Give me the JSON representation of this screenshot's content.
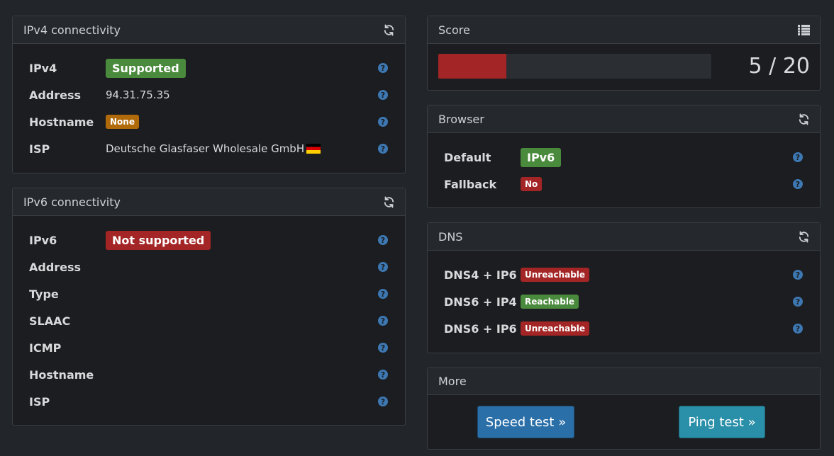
{
  "ipv4": {
    "title": "IPv4 connectivity",
    "rows": [
      {
        "label": "IPv4",
        "value": "Supported"
      },
      {
        "label": "Address",
        "value": "94.31.75.35"
      },
      {
        "label": "Hostname",
        "value": "None"
      },
      {
        "label": "ISP",
        "value": "Deutsche Glasfaser Wholesale GmbH"
      }
    ]
  },
  "ipv6": {
    "title": "IPv6 connectivity",
    "rows": [
      {
        "label": "IPv6",
        "value": "Not supported"
      },
      {
        "label": "Address"
      },
      {
        "label": "Type"
      },
      {
        "label": "SLAAC"
      },
      {
        "label": "ICMP"
      },
      {
        "label": "Hostname"
      },
      {
        "label": "ISP"
      }
    ]
  },
  "score": {
    "title": "Score",
    "text": "5 / 20",
    "fraction": 0.25
  },
  "browser": {
    "title": "Browser",
    "rows": [
      {
        "label": "Default",
        "value": "IPv6"
      },
      {
        "label": "Fallback",
        "value": "No"
      }
    ]
  },
  "dns": {
    "title": "DNS",
    "rows": [
      {
        "label": "DNS4 + IP6",
        "value": "Unreachable"
      },
      {
        "label": "DNS6 + IP4",
        "value": "Reachable"
      },
      {
        "label": "DNS6 + IP6",
        "value": "Unreachable"
      }
    ]
  },
  "more": {
    "title": "More",
    "speed_label": "Speed test »",
    "ping_label": "Ping test »"
  },
  "icons": {
    "refresh": "refresh-icon",
    "list": "list-icon",
    "help": "help-icon",
    "flag": "germany-flag-icon"
  },
  "colors": {
    "success": "#4a8a3c",
    "danger": "#a42525",
    "warning": "#b06a0a",
    "link": "#4a9adb"
  }
}
